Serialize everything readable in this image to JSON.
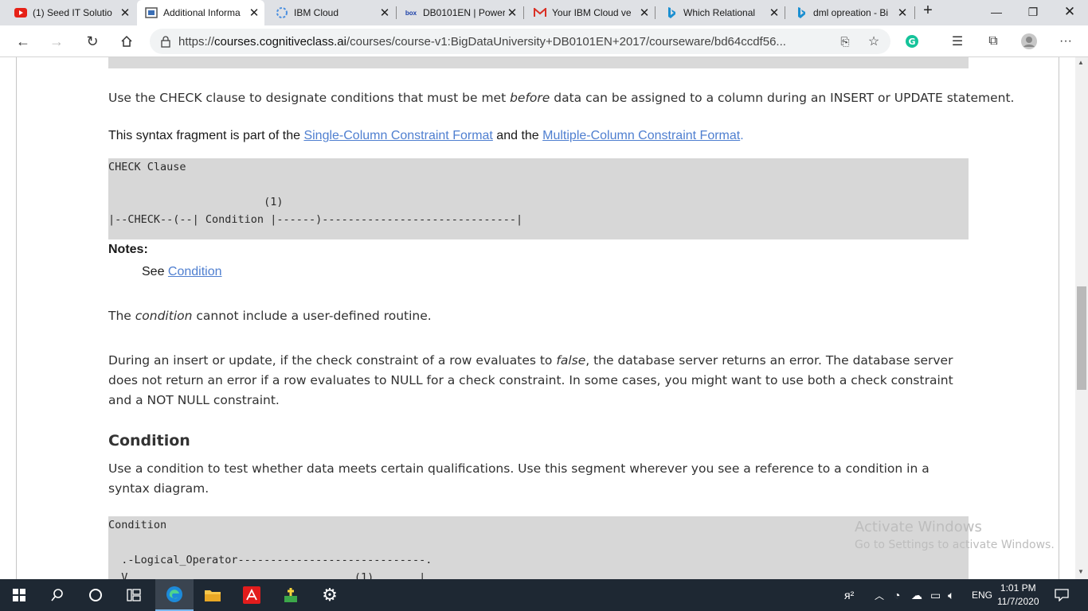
{
  "tabs": [
    {
      "title": "(1) Seed IT Solutio",
      "icon": "youtube-icon"
    },
    {
      "title": "Additional Informa",
      "icon": "cognitiveclass-icon"
    },
    {
      "title": "IBM Cloud",
      "icon": "ibm-cloud-icon"
    },
    {
      "title": "DB0101EN | Power",
      "icon": "box-icon"
    },
    {
      "title": "Your IBM Cloud ve",
      "icon": "gmail-icon"
    },
    {
      "title": "Which Relational",
      "icon": "bing-icon"
    },
    {
      "title": "dml opreation - Bi",
      "icon": "bing-icon"
    }
  ],
  "address": {
    "url_scheme": "https://",
    "url_host": "courses.cognitiveclass.ai",
    "url_path": "/courses/course-v1:BigDataUniversity+DB0101EN+2017/courseware/bd64ccdf56..."
  },
  "content": {
    "check_intro_a": "Use the CHECK clause to designate conditions that must be met ",
    "check_intro_em": "before",
    "check_intro_b": " data can be assigned to a column during an INSERT or UPDATE statement.",
    "fragment_a": "This syntax fragment is part of the ",
    "fragment_link1": "Single-Column Constraint Format",
    "fragment_mid": " and the ",
    "fragment_link2": "Multiple-Column Constraint Format",
    "fragment_end": ".",
    "code1": "CHECK Clause\n\n                        (1)\n|--CHECK--(--| Condition |------)------------------------------|",
    "notes_label": "Notes:",
    "note_see": "See ",
    "note_link": "Condition",
    "cond_text_a": "The ",
    "cond_text_em": "condition",
    "cond_text_b": " cannot include a user-defined routine.",
    "para_a": "During an insert or update, if the check constraint of a row evaluates to ",
    "para_em": "false",
    "para_b": ", the database server returns an error. The database server does not return an error if a row evaluates to NULL for a check constraint. In some cases, you might want to use both a check constraint and a NOT NULL constraint.",
    "condition_heading": "Condition",
    "condition_desc": "Use a condition to test whether data meets certain qualifications. Use this segment wherever you see a reference to a condition in a syntax diagram.",
    "code2": "Condition\n\n  .-Logical_Operator-----------------------------.\n  V                                   (1)       |"
  },
  "watermark": {
    "title": "Activate Windows",
    "subtitle": "Go to Settings to activate Windows."
  },
  "tray": {
    "language": "ENG",
    "time": "1:01 PM",
    "date": "11/7/2020"
  }
}
